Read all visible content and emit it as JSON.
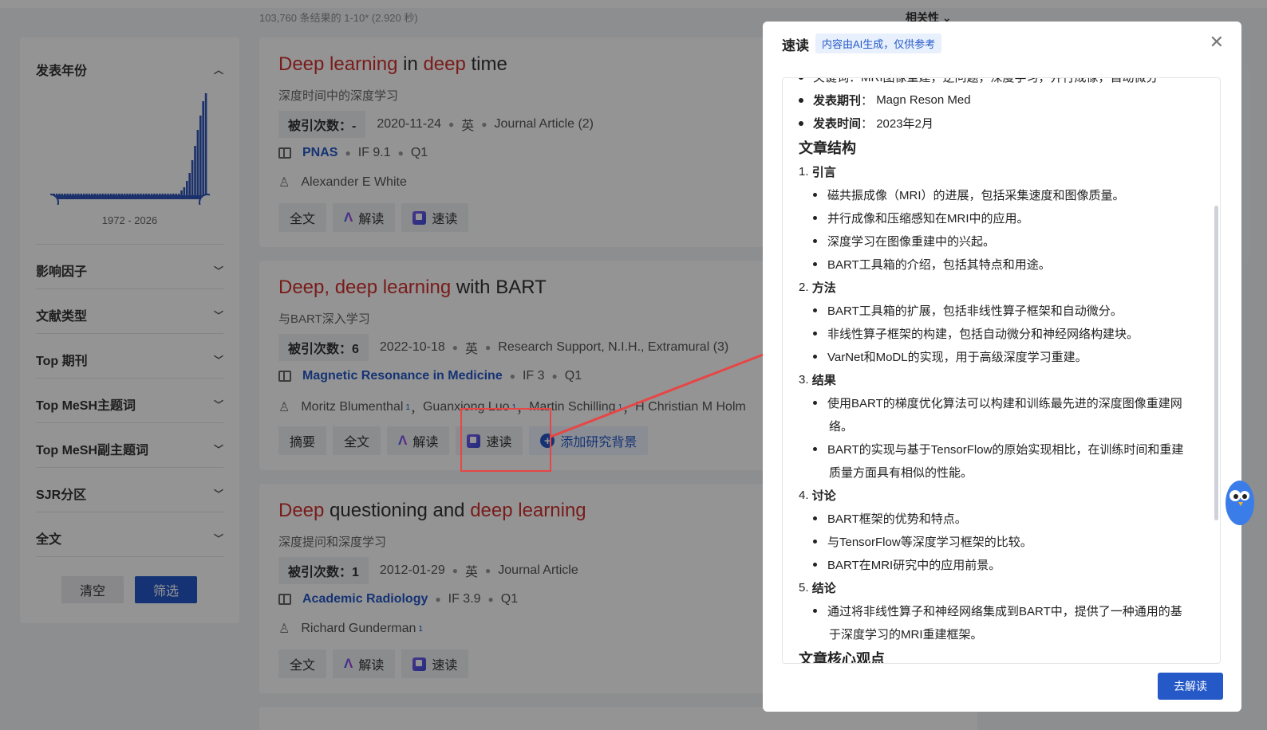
{
  "results_info": "103,760 条结果的 1-10* (2.920 秒)",
  "sort_label": "相关性",
  "sidebar": {
    "year": {
      "label": "发表年份",
      "range": "1972 - 2026"
    },
    "filters": [
      "影响因子",
      "文献类型",
      "Top 期刊",
      "Top MeSH主题词",
      "Top MeSH副主题词",
      "SJR分区",
      "全文"
    ],
    "clear_label": "清空",
    "filter_label": "筛选"
  },
  "results": [
    {
      "title_parts": [
        {
          "text": "Deep learning",
          "hl": true
        },
        {
          "text": " in ",
          "hl": false
        },
        {
          "text": "deep",
          "hl": true
        },
        {
          "text": " time",
          "hl": false
        }
      ],
      "subtitle": "深度时间中的深度学习",
      "cite": "被引次数：-",
      "date": "2020-11-24",
      "lang": "英",
      "type": "Journal Article (2)",
      "journal": "PNAS",
      "if": "IF 9.1",
      "q": "Q1",
      "authors": "Alexander E White",
      "buttons": [
        "全文",
        "解读",
        "速读"
      ]
    },
    {
      "title_parts": [
        {
          "text": "Deep, deep learning",
          "hl": true
        },
        {
          "text": " with BART",
          "hl": false
        }
      ],
      "subtitle": "与BART深入学习",
      "cite": "被引次数：6",
      "date": "2022-10-18",
      "lang": "英",
      "type": "Research Support, N.I.H., Extramural (3)",
      "journal": "Magnetic Resonance in Medicine",
      "if": "IF 3",
      "q": "Q1",
      "authors": [
        "Moritz Blumenthal",
        "Guanxiong Luo",
        "Martin Schilling",
        "H Christian M Holm"
      ],
      "buttons": [
        "摘要",
        "全文",
        "解读",
        "速读",
        "添加研究背景"
      ]
    },
    {
      "title_parts": [
        {
          "text": "Deep",
          "hl": true
        },
        {
          "text": " questioning and ",
          "hl": false
        },
        {
          "text": "deep learning",
          "hl": true
        }
      ],
      "subtitle": "深度提问和深度学习",
      "cite": "被引次数：1",
      "date": "2012-01-29",
      "lang": "英",
      "type": "Journal Article",
      "journal": "Academic Radiology",
      "if": "IF 3.9",
      "q": "Q1",
      "authors": "Richard Gunderman",
      "buttons": [
        "全文",
        "解读",
        "速读"
      ]
    }
  ],
  "panel": {
    "title": "速读",
    "badge": "内容由AI生成，仅供参考",
    "top_cut": "关键词：MRI图像重建，逆问题，深度学习，并行成像，自动微分",
    "journal_label": "发表期刊",
    "journal_value": "Magn Reson Med",
    "date_label": "发表时间",
    "date_value": "2023年2月",
    "structure_heading": "文章结构",
    "sections": [
      {
        "n": "1.",
        "name": "引言",
        "items": [
          "磁共振成像（MRI）的进展，包括采集速度和图像质量。",
          "并行成像和压缩感知在MRI中的应用。",
          "深度学习在图像重建中的兴起。",
          "BART工具箱的介绍，包括其特点和用途。"
        ]
      },
      {
        "n": "2.",
        "name": "方法",
        "items": [
          "BART工具箱的扩展，包括非线性算子框架和自动微分。",
          "非线性算子框架的构建，包括自动微分和神经网络构建块。",
          "VarNet和MoDL的实现，用于高级深度学习重建。"
        ]
      },
      {
        "n": "3.",
        "name": "结果",
        "items": [
          [
            "使用BART的梯度优化算法可以构建和训练最先进的深度图像重建网",
            "络。"
          ],
          [
            "BART的实现与基于TensorFlow的原始实现相比，在训练时间和重建",
            "质量方面具有相似的性能。"
          ]
        ]
      },
      {
        "n": "4.",
        "name": "讨论",
        "items": [
          "BART框架的优势和特点。",
          "与TensorFlow等深度学习框架的比较。",
          "BART在MRI研究中的应用前景。"
        ]
      },
      {
        "n": "5.",
        "name": "结论",
        "items": [
          [
            "通过将非线性算子和神经网络集成到BART中，提供了一种通用的基",
            "于深度学习的MRI重建框架。"
          ]
        ]
      }
    ],
    "core_heading": "文章核心观点",
    "go_label": "去解读"
  }
}
